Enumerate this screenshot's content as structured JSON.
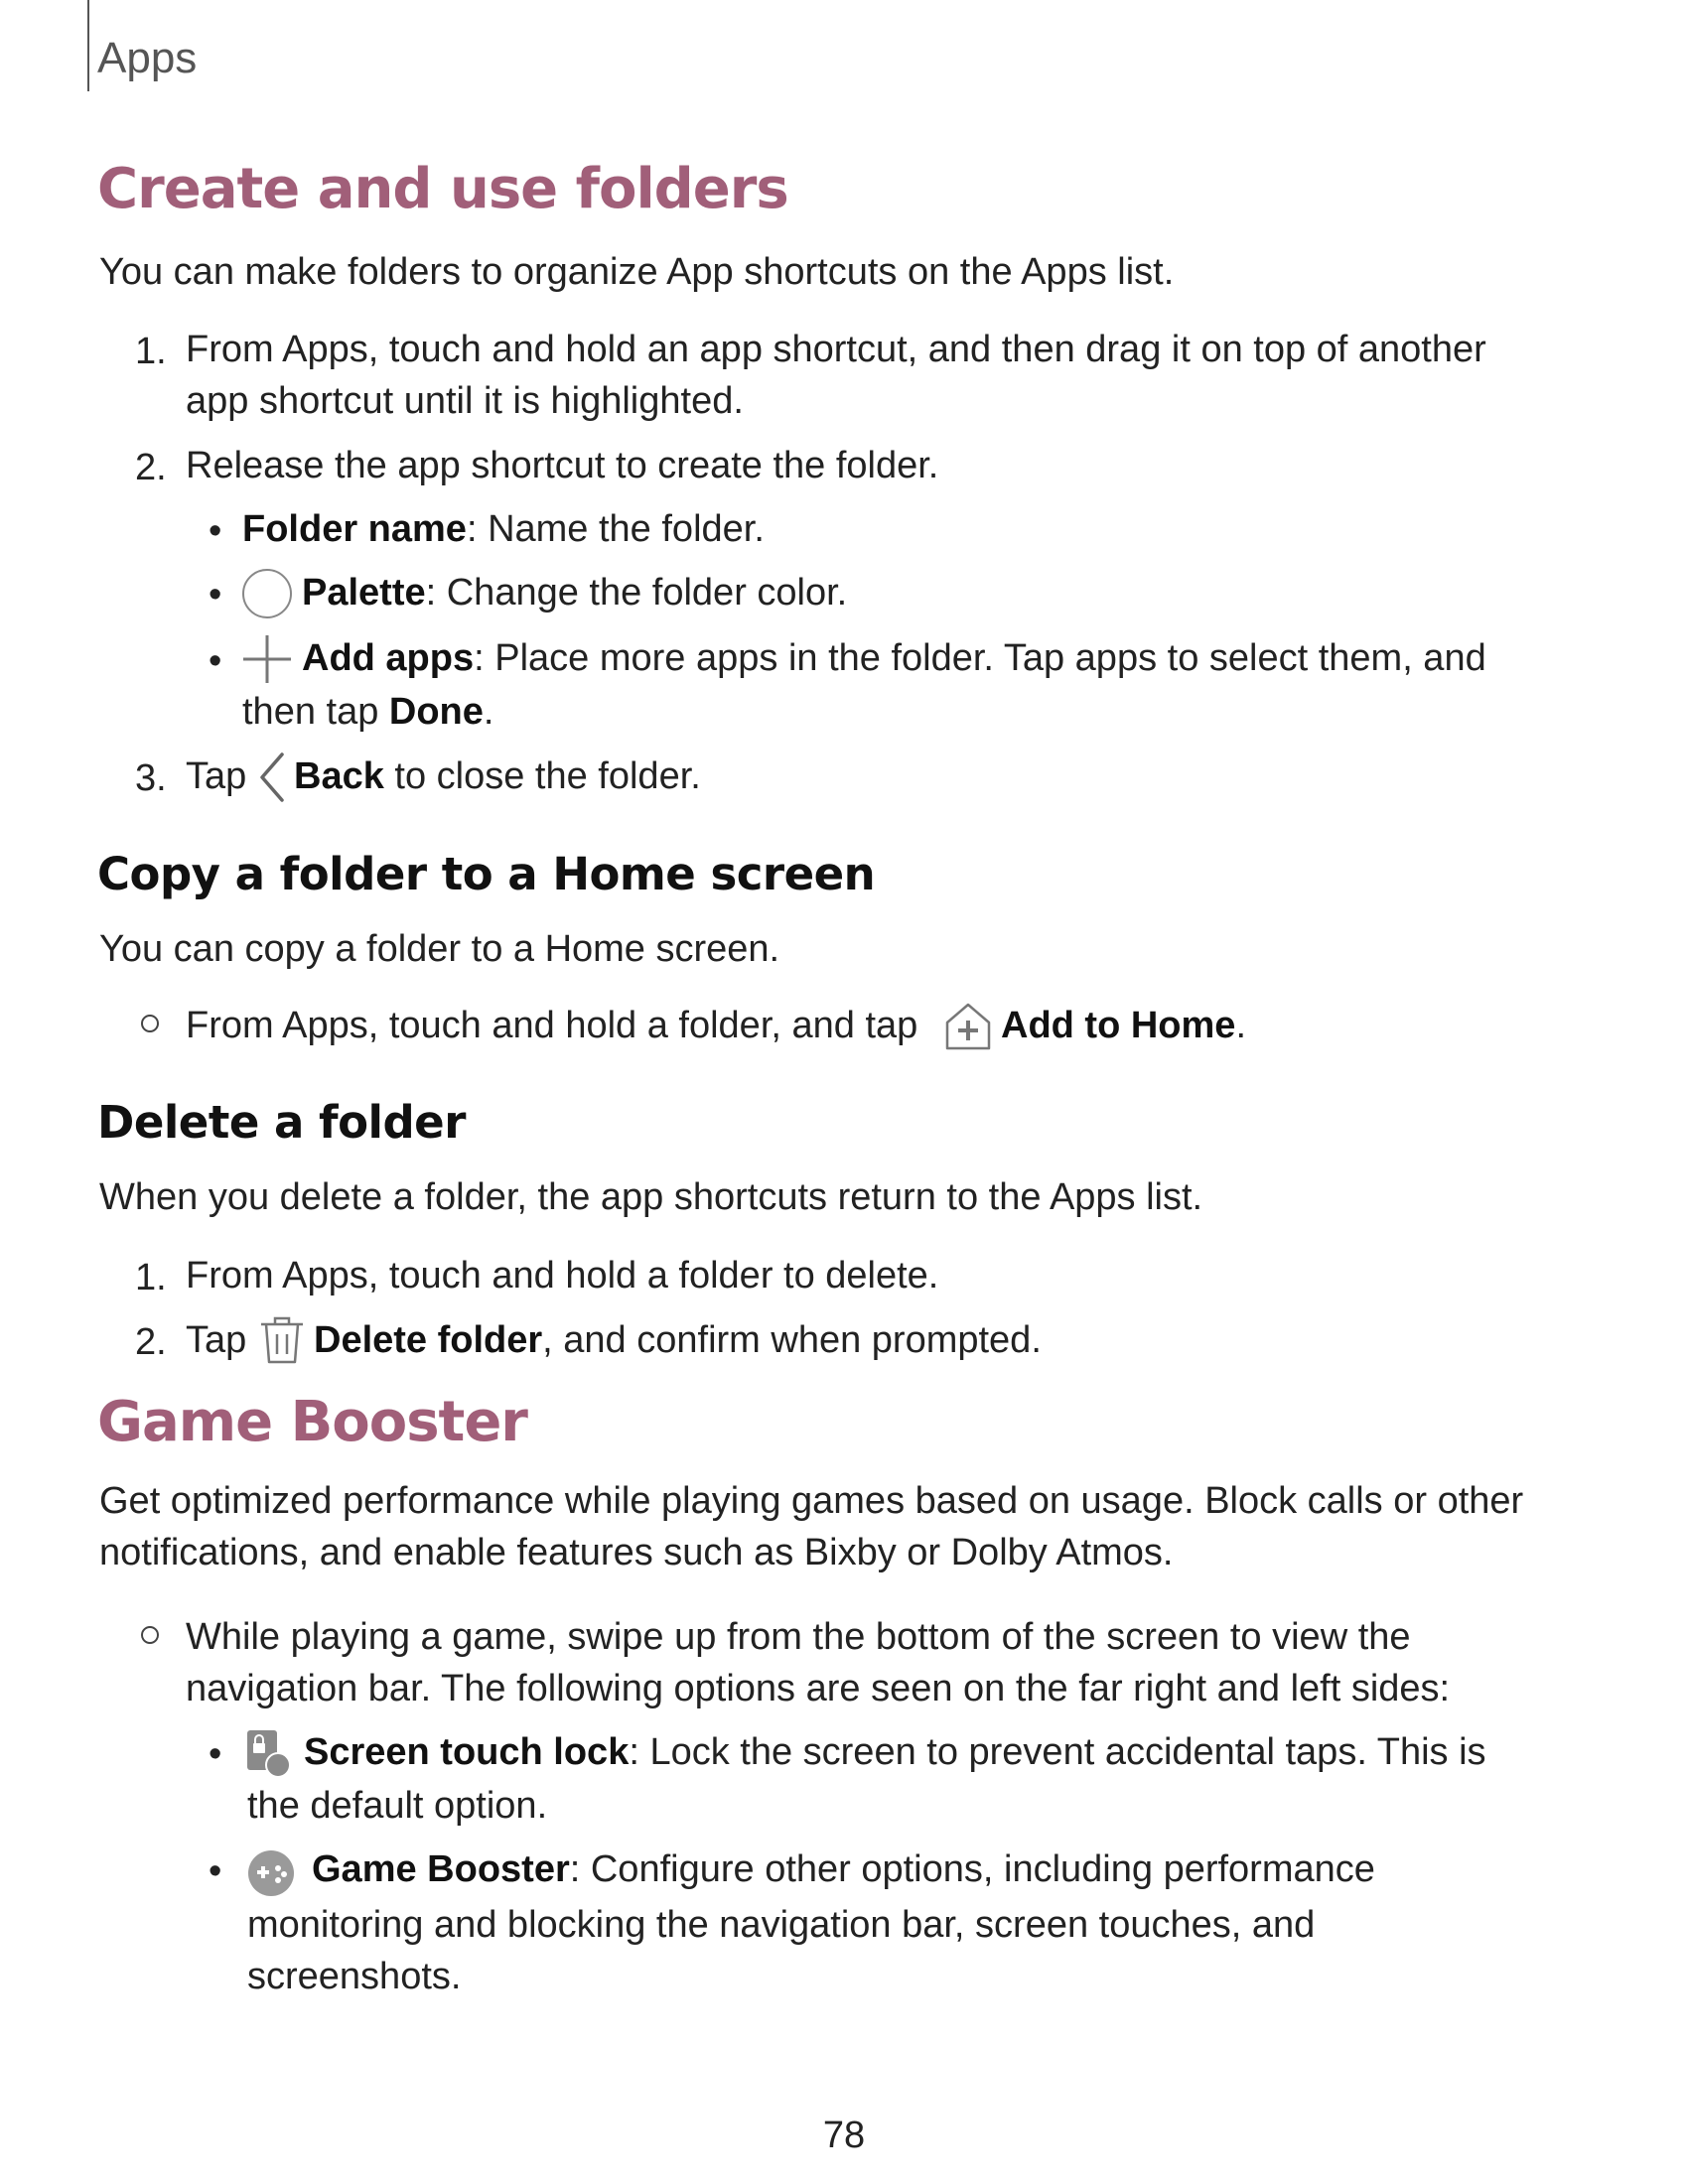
{
  "header": {
    "section": "Apps"
  },
  "create_folders": {
    "title": "Create and use folders",
    "intro": "You can make folders to organize App shortcuts on the Apps list.",
    "step1_num": "1.",
    "step1_line1": "From Apps, touch and hold an app shortcut, and then drag it on top of another",
    "step1_line2": "app shortcut until it is highlighted.",
    "step2_num": "2.",
    "step2": "Release the app shortcut to create the folder.",
    "bullet_folder_name_label": "Folder name",
    "bullet_folder_name_text": ": Name the folder.",
    "bullet_palette_label": "Palette",
    "bullet_palette_text": ": Change the folder color.",
    "bullet_add_apps_label": "Add apps",
    "bullet_add_apps_text": ": Place more apps in the folder. Tap apps to select them, and",
    "bullet_add_apps_line2_pre": "then tap ",
    "bullet_add_apps_line2_bold": "Done",
    "bullet_add_apps_line2_post": ".",
    "step3_num": "3.",
    "step3_pre": "Tap ",
    "step3_label": "Back",
    "step3_post": " to close the folder."
  },
  "copy_folder": {
    "title": "Copy a folder to a Home screen",
    "intro": "You can copy a folder to a Home screen.",
    "item_pre": "From Apps, touch and hold a folder, and tap ",
    "item_label": "Add to Home",
    "item_post": "."
  },
  "delete_folder": {
    "title": "Delete a folder",
    "intro": "When you delete a folder, the app shortcuts return to the Apps list.",
    "step1_num": "1.",
    "step1": "From Apps, touch and hold a folder to delete.",
    "step2_num": "2.",
    "step2_pre": "Tap ",
    "step2_label": "Delete folder",
    "step2_post": ", and confirm when prompted."
  },
  "game_booster": {
    "title": "Game Booster",
    "intro_line1": "Get optimized performance while playing games based on usage. Block calls or other",
    "intro_line2": "notifications, and enable features such as Bixby or Dolby Atmos.",
    "item_line1": "While playing a game, swipe up from the bottom of the screen to view the",
    "item_line2": "navigation bar. The following options are seen on the far right and left sides:",
    "bullet_lock_label": "Screen touch lock",
    "bullet_lock_text": ": Lock the screen to prevent accidental taps. This is",
    "bullet_lock_line2": "the default option.",
    "bullet_gb_label": "Game Booster",
    "bullet_gb_text": ": Configure other options, including performance",
    "bullet_gb_line2": "monitoring and blocking the navigation bar, screen touches, and",
    "bullet_gb_line3": "screenshots."
  },
  "footer": {
    "page_number": "78"
  }
}
